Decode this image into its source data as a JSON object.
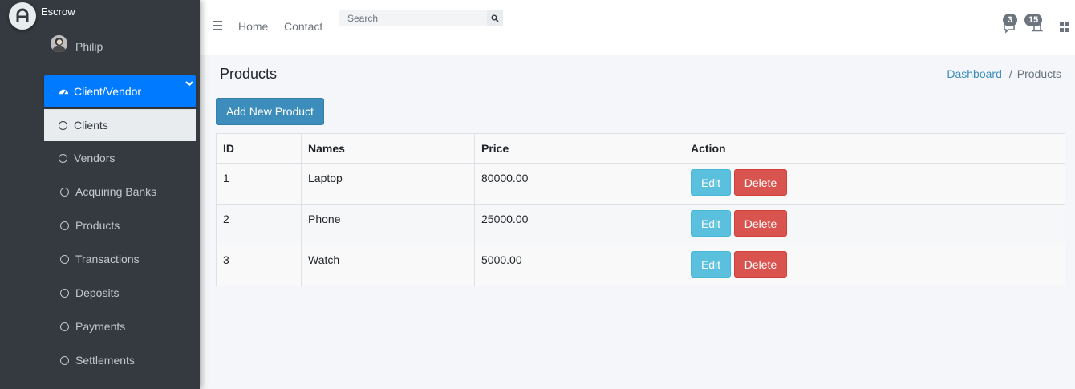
{
  "brand": {
    "name": "Escrow",
    "logo_icon": "escrow-logo-icon"
  },
  "user": {
    "name": "Philip"
  },
  "sidebar": {
    "parent": {
      "label": "Client/Vendor",
      "icon": "dashboard-icon",
      "accent": "#007bff"
    },
    "items": [
      {
        "label": "Clients",
        "active": true
      },
      {
        "label": "Vendors"
      },
      {
        "label": "Acquiring Banks"
      },
      {
        "label": "Products"
      },
      {
        "label": "Transactions"
      },
      {
        "label": "Deposits"
      },
      {
        "label": "Payments"
      },
      {
        "label": "Settlements"
      }
    ]
  },
  "topbar": {
    "links": [
      "Home",
      "Contact"
    ],
    "search_placeholder": "Search",
    "messages_count": "3",
    "notifications_count": "15"
  },
  "page": {
    "title": "Products",
    "breadcrumb": [
      "Dashboard",
      "Products"
    ],
    "add_button": "Add New Product"
  },
  "table": {
    "columns": [
      "ID",
      "Names",
      "Price",
      "Action"
    ],
    "rows": [
      {
        "id": "1",
        "name": "Laptop",
        "price": "80000.00"
      },
      {
        "id": "2",
        "name": "Phone",
        "price": "25000.00"
      },
      {
        "id": "3",
        "name": "Watch",
        "price": "5000.00"
      }
    ],
    "edit_label": "Edit",
    "delete_label": "Delete"
  },
  "colors": {
    "sidebar": "#343a40",
    "primary": "#3c8dbc",
    "edit": "#5bc0de",
    "delete": "#d9534f"
  }
}
